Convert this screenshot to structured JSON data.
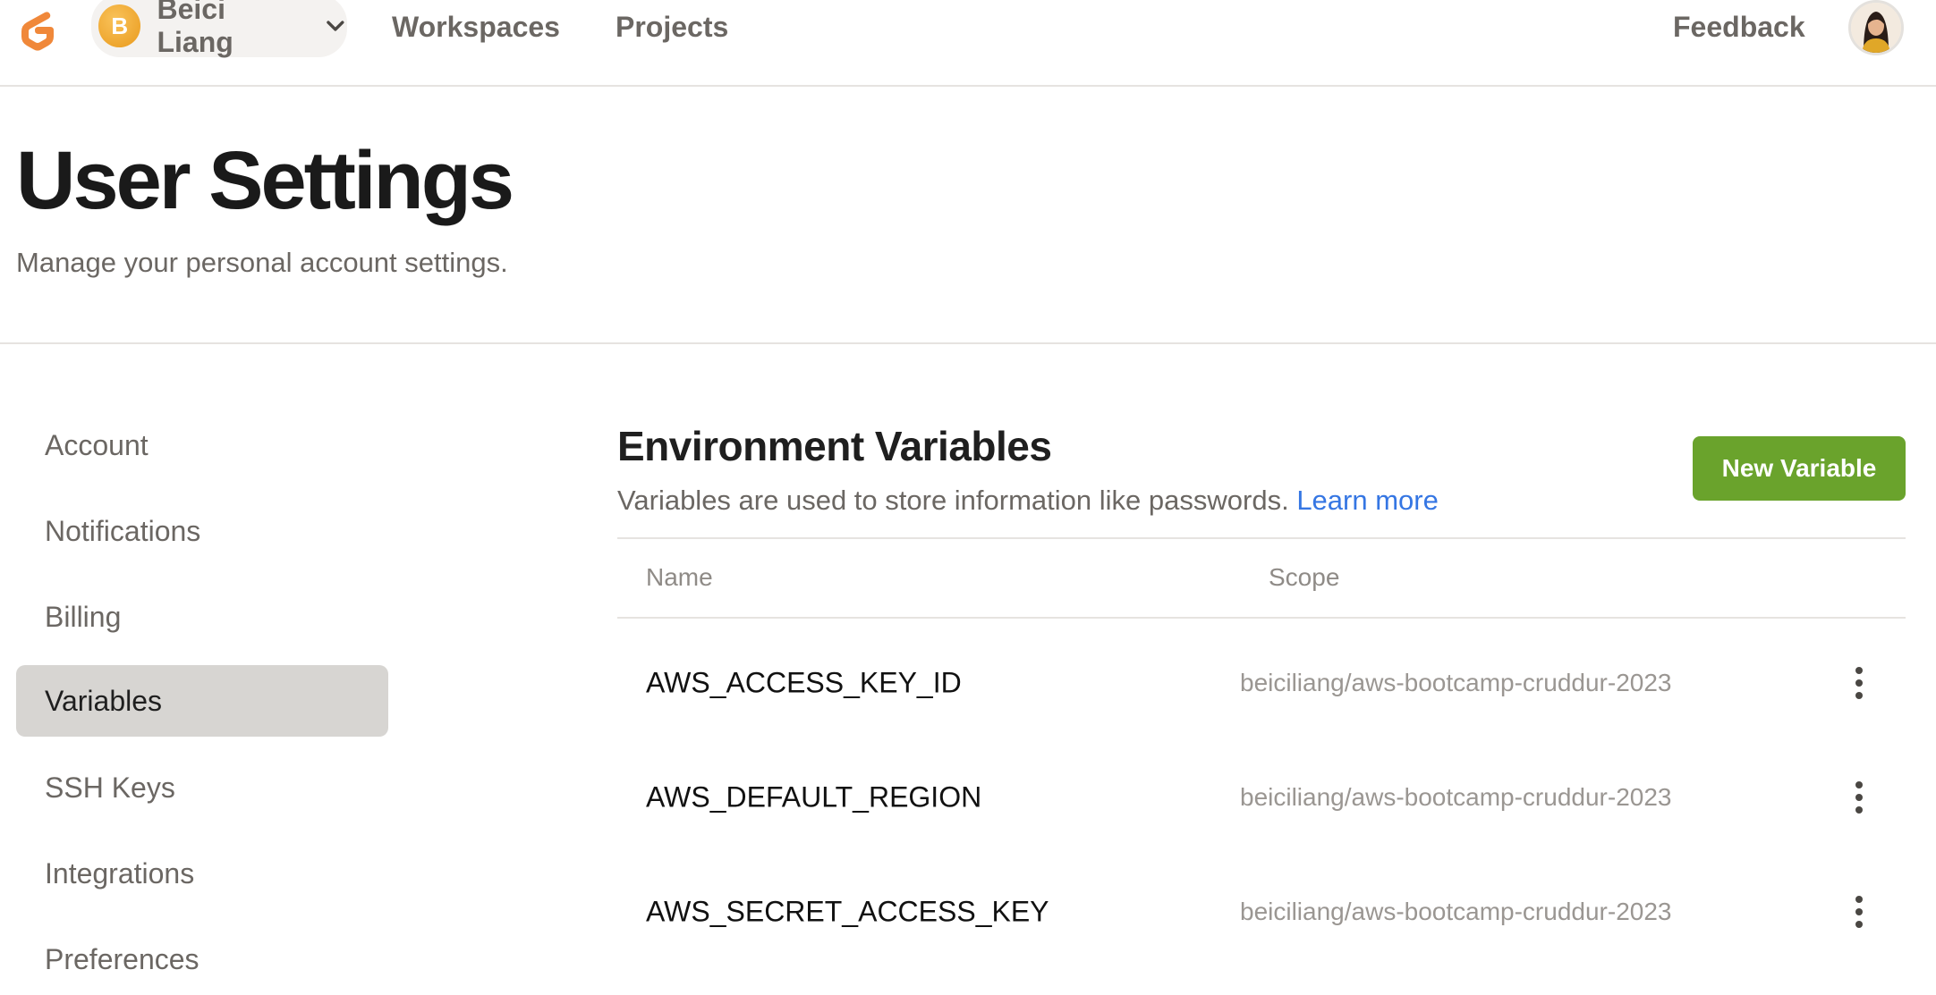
{
  "topbar": {
    "workspace_initial": "B",
    "workspace_name": "Beici Liang",
    "nav": {
      "workspaces": "Workspaces",
      "projects": "Projects",
      "feedback": "Feedback"
    }
  },
  "header": {
    "title": "User Settings",
    "subtitle": "Manage your personal account settings."
  },
  "sidebar": {
    "items": [
      {
        "label": "Account",
        "active": false
      },
      {
        "label": "Notifications",
        "active": false
      },
      {
        "label": "Billing",
        "active": false
      },
      {
        "label": "Variables",
        "active": true
      },
      {
        "label": "SSH Keys",
        "active": false
      },
      {
        "label": "Integrations",
        "active": false
      },
      {
        "label": "Preferences",
        "active": false
      }
    ]
  },
  "main": {
    "title": "Environment Variables",
    "description": "Variables are used to store information like passwords.",
    "learn_more": "Learn more",
    "new_button": "New Variable",
    "columns": {
      "name": "Name",
      "scope": "Scope"
    },
    "rows": [
      {
        "name": "AWS_ACCESS_KEY_ID",
        "scope": "beiciliang/aws-bootcamp-cruddur-2023"
      },
      {
        "name": "AWS_DEFAULT_REGION",
        "scope": "beiciliang/aws-bootcamp-cruddur-2023"
      },
      {
        "name": "AWS_SECRET_ACCESS_KEY",
        "scope": "beiciliang/aws-bootcamp-cruddur-2023"
      }
    ]
  },
  "colors": {
    "accent_green": "#6aa32c",
    "link_blue": "#3576e3",
    "logo_orange": "#f0883a",
    "active_nav_bg": "#d7d5d2"
  }
}
